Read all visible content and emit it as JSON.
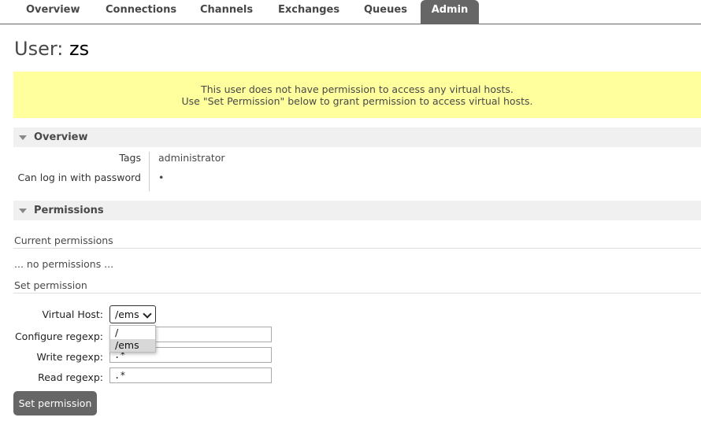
{
  "nav": {
    "tabs": [
      {
        "label": "Overview"
      },
      {
        "label": "Connections"
      },
      {
        "label": "Channels"
      },
      {
        "label": "Exchanges"
      },
      {
        "label": "Queues"
      },
      {
        "label": "Admin"
      }
    ],
    "active": "Admin"
  },
  "page": {
    "title_prefix": "User:",
    "user_name": "zs"
  },
  "warning": {
    "line1": "This user does not have permission to access any virtual hosts.",
    "line2": "Use \"Set Permission\" below to grant permission to access virtual hosts."
  },
  "overview": {
    "header": "Overview",
    "tags_label": "Tags",
    "tags_value": "administrator",
    "login_label": "Can log in with password",
    "login_value": "•"
  },
  "permissions": {
    "header": "Permissions",
    "current_heading": "Current permissions",
    "current_empty": "... no permissions ...",
    "set_heading": "Set permission",
    "vhost_label": "Virtual Host:",
    "vhost_selected": "/ems",
    "vhost_options": [
      "/",
      "/ems"
    ],
    "configure_label": "Configure regexp:",
    "configure_value": "",
    "write_label": "Write regexp:",
    "write_value": ".*",
    "read_label": "Read regexp:",
    "read_value": ".*",
    "submit_label": "Set permission"
  },
  "colors": {
    "nav_active_bg": "#666666",
    "warning_bg": "#ffff9e",
    "section_bg": "#f0f0f0",
    "button_bg": "#666666"
  }
}
